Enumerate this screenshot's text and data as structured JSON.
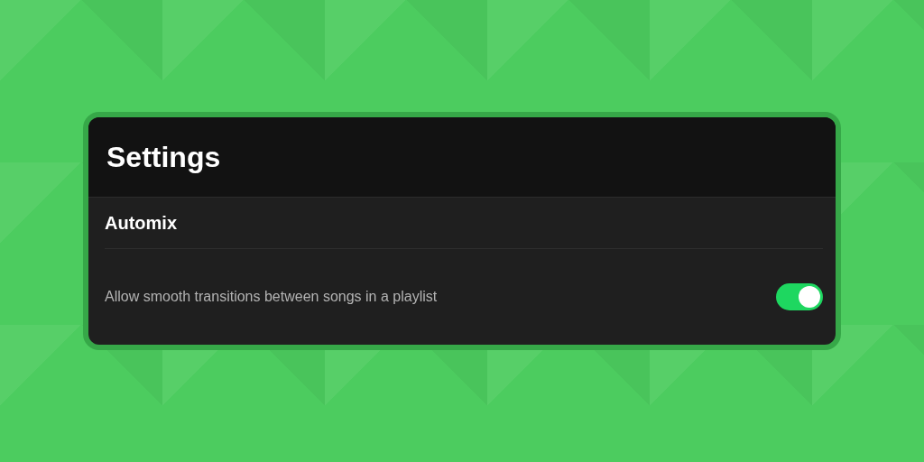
{
  "window": {
    "title": "Settings"
  },
  "section": {
    "title": "Automix"
  },
  "settings": [
    {
      "kind": "toggle",
      "label": "Allow smooth transitions between songs in a playlist",
      "on": true
    }
  ]
}
